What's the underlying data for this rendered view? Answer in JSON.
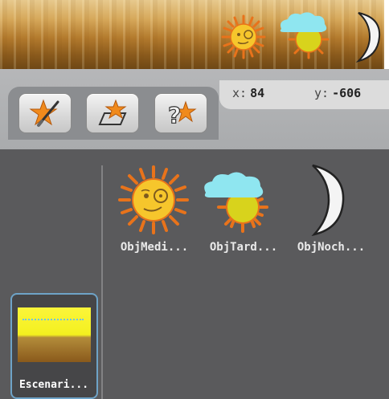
{
  "stage": {
    "sprites": [
      "sun-mediodia",
      "sun-tarde-cloud",
      "moon-noche"
    ]
  },
  "coords": {
    "x_label": "x:",
    "x_value": "84",
    "y_label": "y:",
    "y_value": "-606"
  },
  "toolbar": {
    "buttons": [
      {
        "name": "paint-new-sprite-button",
        "icon": "star-paintbrush-icon"
      },
      {
        "name": "choose-sprite-from-file-button",
        "icon": "star-folder-icon"
      },
      {
        "name": "surprise-sprite-button",
        "icon": "star-question-icon"
      }
    ]
  },
  "sprites": [
    {
      "label": "ObjMedi...",
      "icon": "sun-face-icon"
    },
    {
      "label": "ObjTard...",
      "icon": "sun-cloud-icon"
    },
    {
      "label": "ObjNoch...",
      "icon": "moon-icon"
    }
  ],
  "stage_card": {
    "label": "Escenari..."
  }
}
